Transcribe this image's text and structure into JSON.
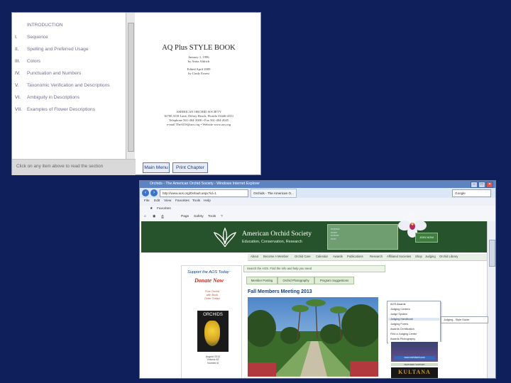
{
  "stylebook": {
    "toc": [
      {
        "num": "",
        "label": "INTRODUCTION"
      },
      {
        "num": "I.",
        "label": "Sequence"
      },
      {
        "num": "II.",
        "label": "Spelling and Preferred Usage"
      },
      {
        "num": "III.",
        "label": "Colors"
      },
      {
        "num": "IV.",
        "label": "Punctuation and Numbers"
      },
      {
        "num": "V.",
        "label": "Taxonomic Verification and Descriptions"
      },
      {
        "num": "VI.",
        "label": "Ambiguity in Descriptions"
      },
      {
        "num": "VII.",
        "label": "Examples of Flower Descriptions"
      }
    ],
    "footer_hint": "Click on any item above to read the section",
    "title": "AQ Plus STYLE BOOK",
    "date1": "January 1, 1996",
    "author1": "by Anita Aldrich",
    "date2": "Edited April 2009",
    "author2": "by Cindy Ernest",
    "society": "AMERICAN ORCHID SOCIETY",
    "address": "16700 AOS Lane, Delray Beach, Florida 33446-4351",
    "phone": "Telephone 561-404-2000 • Fax 561-404-2045",
    "contact": "e-mail TheAOS@aos.org • Website www.aos.org",
    "main_menu_btn": "Main Menu",
    "print_chapter_btn": "Print Chapter"
  },
  "ie": {
    "title": "Orchids - The American Orchid Society - Windows Internet Explorer",
    "address": "http://www.aos.org/Default.aspx?id=1",
    "tab1": "Orchids - The American O...",
    "search_hint": "Google",
    "menu": [
      "File",
      "Edit",
      "View",
      "Favorites",
      "Tools",
      "Help"
    ],
    "favorites": "Favorites",
    "commands": [
      "Page",
      "Safety",
      "Tools"
    ],
    "header": {
      "name": "American Orchid Society",
      "tagline": "Education, Conservation, Research",
      "join": "JOIN NOW"
    },
    "nav": [
      "About",
      "Become A Member",
      "Orchid Care",
      "Calendar",
      "Awards",
      "Publications",
      "Research",
      "Affiliated Societies",
      "Shop",
      "Judging",
      "Orchid Library"
    ],
    "sidebar": {
      "support": "Support the AOS Today",
      "donate": "Donate Now",
      "mini": [
        "Free Orchid",
        "with Book",
        "Order Today!"
      ],
      "book_label": "ORCHIDS",
      "caption": [
        "August 2013",
        "Volume 82",
        "Number 8"
      ]
    },
    "main": {
      "search": "Search the AOS. Find the info and help you need",
      "tabs": [
        "Member Posting",
        "Orchid Photography",
        "Program Suggestions"
      ],
      "meeting": "Fall Members Meeting 2013"
    },
    "dropdown": [
      "AOS Awards",
      "Judging Centers",
      "Judge System",
      "Judging Handbook",
      "Judging Forms",
      "Awards Certification",
      "Find a Judging Center",
      "Awards Photography"
    ],
    "submenu": "Judging - Style Guide",
    "right_ads": {
      "bar": "www.orchidweb.com",
      "section": "FEATURED SUPPORT",
      "kultana": "KULTANA"
    }
  }
}
